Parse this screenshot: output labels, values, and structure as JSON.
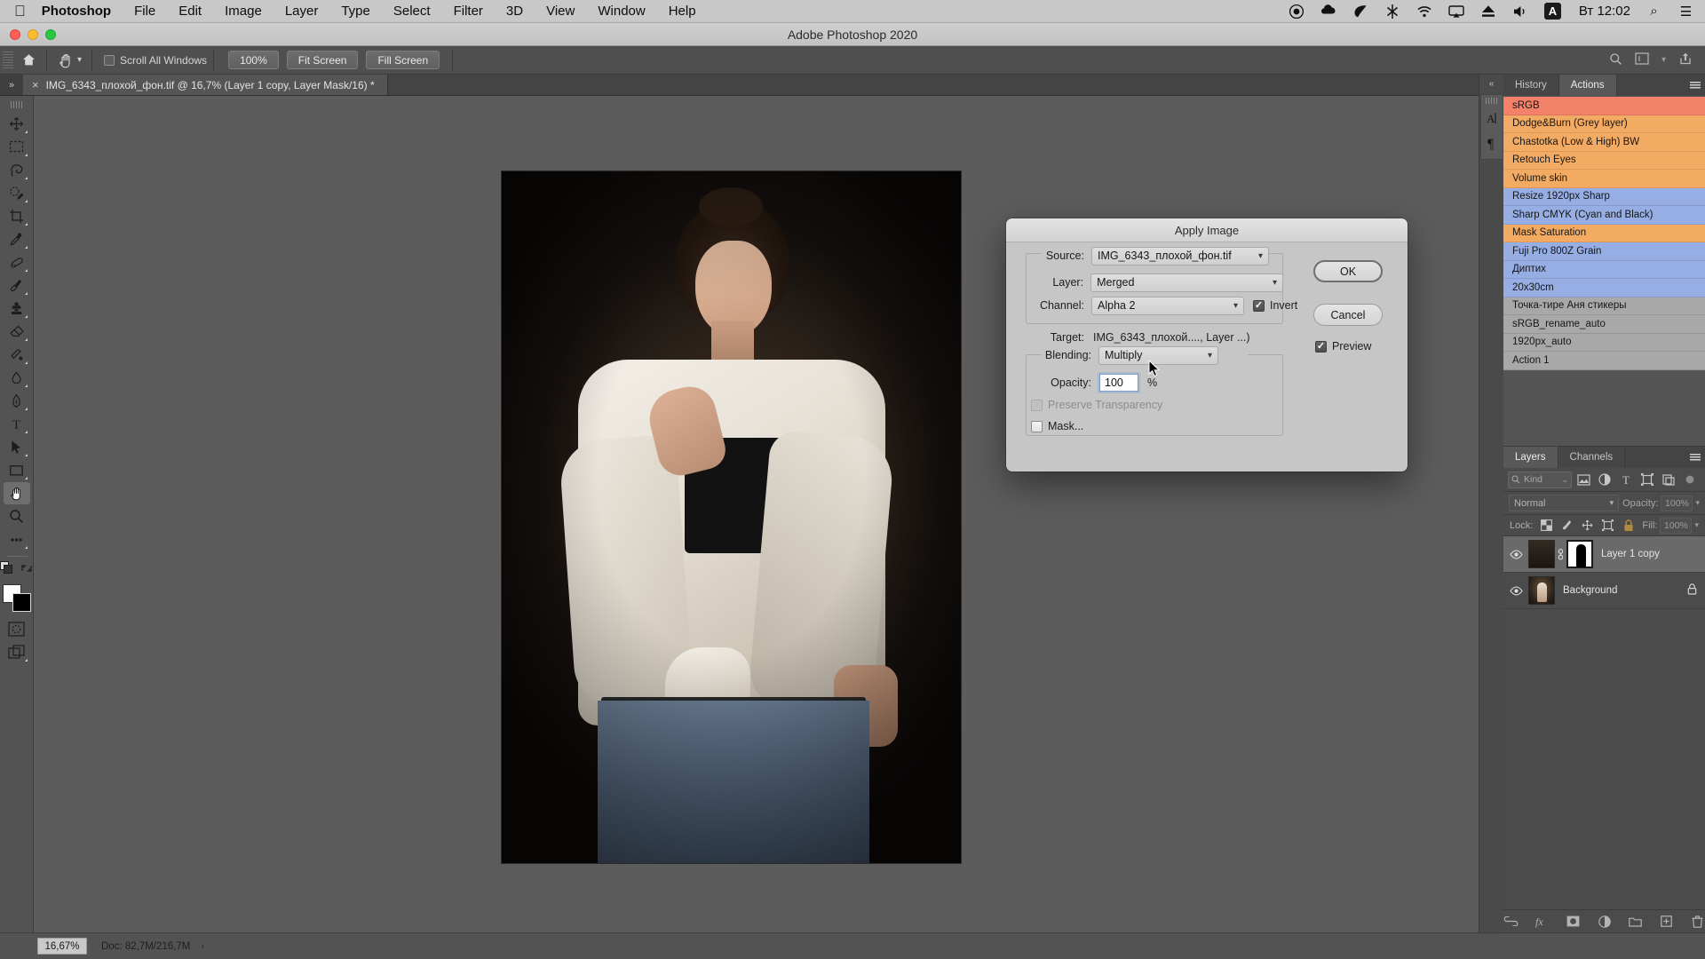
{
  "menubar": {
    "apple": "",
    "items": [
      {
        "label": "Photoshop",
        "bold": true
      },
      {
        "label": "File"
      },
      {
        "label": "Edit"
      },
      {
        "label": "Image"
      },
      {
        "label": "Layer"
      },
      {
        "label": "Type"
      },
      {
        "label": "Select"
      },
      {
        "label": "Filter"
      },
      {
        "label": "3D"
      },
      {
        "label": "View"
      },
      {
        "label": "Window"
      },
      {
        "label": "Help"
      }
    ],
    "status_icons": [
      {
        "name": "screen-record-icon",
        "glyph": "◉"
      },
      {
        "name": "creative-cloud-icon",
        "glyph": "❦"
      },
      {
        "name": "leaf-icon",
        "glyph": "🍃"
      },
      {
        "name": "bluetooth-mouse-icon",
        "glyph": "✳"
      },
      {
        "name": "wifi-icon",
        "glyph": "≋"
      },
      {
        "name": "airplay-icon",
        "glyph": "▭"
      },
      {
        "name": "eject-icon",
        "glyph": "⏏"
      },
      {
        "name": "volume-icon",
        "glyph": "🔊"
      }
    ],
    "input_badge": "A",
    "clock": "Вт 12:02",
    "search_icon": "⌕",
    "control_center_icon": "☰"
  },
  "window": {
    "title": "Adobe Photoshop 2020"
  },
  "options_bar": {
    "home_icon": "⌂",
    "tool_icon": "hand-tool-icon",
    "scroll_all_windows_label": "Scroll All Windows",
    "scroll_all_windows_checked": false,
    "buttons": [
      "100%",
      "Fit Screen",
      "Fill Screen"
    ],
    "right_icons": [
      {
        "name": "search-icon",
        "glyph": "⌕"
      },
      {
        "name": "workspace-icon",
        "glyph": "▤"
      },
      {
        "name": "chevron-down-icon",
        "glyph": "⌄"
      },
      {
        "name": "share-icon",
        "glyph": "⇧"
      }
    ]
  },
  "document_tab": {
    "collapse_icon": "»",
    "close_icon": "×",
    "title": "IMG_6343_плохой_фон.tif @ 16,7% (Layer 1 copy, Layer Mask/16) *"
  },
  "toolbar": {
    "tools": [
      {
        "name": "move-tool",
        "active": false
      },
      {
        "name": "rectangular-marquee-tool",
        "active": false
      },
      {
        "name": "lasso-tool",
        "active": false
      },
      {
        "name": "quick-selection-tool",
        "active": false
      },
      {
        "name": "crop-tool",
        "active": false
      },
      {
        "name": "eyedropper-tool",
        "active": false
      },
      {
        "name": "healing-brush-tool",
        "active": false
      },
      {
        "name": "brush-tool",
        "active": false
      },
      {
        "name": "clone-stamp-tool",
        "active": false
      },
      {
        "name": "eraser-tool",
        "active": false
      },
      {
        "name": "gradient-tool",
        "active": false
      },
      {
        "name": "blur-tool",
        "active": false
      },
      {
        "name": "pen-tool",
        "active": false
      },
      {
        "name": "type-tool",
        "active": false
      },
      {
        "name": "path-selection-tool",
        "active": false
      },
      {
        "name": "rectangle-tool",
        "active": false
      },
      {
        "name": "hand-tool",
        "active": true
      },
      {
        "name": "zoom-tool",
        "active": false
      },
      {
        "name": "edit-toolbar-tool",
        "active": false
      }
    ],
    "foreground_color": "#ffffff",
    "background_color": "#000000"
  },
  "collapsed_panels": {
    "arrow": "«",
    "items": [
      {
        "name": "character-panel-icon",
        "glyph": "A|"
      },
      {
        "name": "paragraph-panel-icon",
        "glyph": "¶"
      }
    ]
  },
  "actions_panel": {
    "tabs": [
      {
        "label": "History",
        "active": false
      },
      {
        "label": "Actions",
        "active": true
      }
    ],
    "menu_icon": "panel-menu-icon",
    "items": [
      {
        "label": "sRGB",
        "color": "#f4816a"
      },
      {
        "label": "Dodge&Burn (Grey layer)",
        "color": "#f3ab63"
      },
      {
        "label": "Chastotka (Low & High) BW",
        "color": "#f3ab63"
      },
      {
        "label": "Retouch Eyes",
        "color": "#f3ab63"
      },
      {
        "label": "Volume skin",
        "color": "#f3ab63"
      },
      {
        "label": "Resize 1920px Sharp",
        "color": "#96aee4"
      },
      {
        "label": "Sharp CMYK (Cyan and Black)",
        "color": "#96aee4"
      },
      {
        "label": "Mask Saturation",
        "color": "#f3ab63"
      },
      {
        "label": "Fuji Pro 800Z Grain",
        "color": "#96aee4"
      },
      {
        "label": "Диптих",
        "color": "#96aee4"
      },
      {
        "label": "20x30cm",
        "color": "#96aee4"
      },
      {
        "label": "Точка-тире Аня стикеры",
        "color": "#a8a8a8"
      },
      {
        "label": "sRGB_rename_auto",
        "color": "#a8a8a8"
      },
      {
        "label": "1920px_auto",
        "color": "#a8a8a8"
      },
      {
        "label": "Action 1",
        "color": "#a8a8a8"
      }
    ]
  },
  "layers_panel": {
    "tabs": [
      {
        "label": "Layers",
        "active": true
      },
      {
        "label": "Channels",
        "active": false
      }
    ],
    "menu_icon": "panel-menu-icon",
    "filter": {
      "search_icon": "search-icon",
      "kind_label": "Kind",
      "chevron": "⌄",
      "type_icons": [
        {
          "name": "filter-pixel-icon",
          "glyph": "▣"
        },
        {
          "name": "filter-adjustment-icon",
          "glyph": "◐"
        },
        {
          "name": "filter-type-icon",
          "glyph": "T"
        },
        {
          "name": "filter-shape-icon",
          "glyph": "⬚"
        },
        {
          "name": "filter-smart-object-icon",
          "glyph": "❐"
        }
      ],
      "toggle_icon": "filter-toggle-icon"
    },
    "blend_mode": "Normal",
    "opacity_label": "Opacity:",
    "opacity_value": "100%",
    "lock_label": "Lock:",
    "lock_icons": [
      {
        "name": "lock-transparent-pixels-icon",
        "glyph": "▨"
      },
      {
        "name": "lock-image-pixels-icon",
        "glyph": "✎"
      },
      {
        "name": "lock-position-icon",
        "glyph": "✥"
      },
      {
        "name": "lock-artboard-icon",
        "glyph": "⬚"
      },
      {
        "name": "lock-all-icon",
        "glyph": "🔒"
      }
    ],
    "fill_label": "Fill:",
    "fill_value": "100%",
    "layers": [
      {
        "name": "Layer 1 copy",
        "selected": true,
        "visible": true,
        "has_mask": true,
        "locked": false
      },
      {
        "name": "Background",
        "selected": false,
        "visible": true,
        "has_mask": false,
        "locked": true
      }
    ],
    "bottom_icons": [
      {
        "name": "link-layers-icon",
        "glyph": "⛓"
      },
      {
        "name": "layer-style-fx-icon",
        "glyph": "fx"
      },
      {
        "name": "add-layer-mask-icon",
        "glyph": "◧"
      },
      {
        "name": "new-adjustment-layer-icon",
        "glyph": "◑"
      },
      {
        "name": "new-group-icon",
        "glyph": "▭"
      },
      {
        "name": "new-layer-icon",
        "glyph": "⊞"
      },
      {
        "name": "delete-layer-icon",
        "glyph": "🗑"
      }
    ]
  },
  "status_bar": {
    "zoom": "16,67%",
    "doc_info": "Doc: 82,7M/216,7M",
    "arrow": "›"
  },
  "dialog": {
    "title": "Apply Image",
    "source_label": "Source:",
    "source_value": "IMG_6343_плохой_фон.tif",
    "layer_label": "Layer:",
    "layer_value": "Merged",
    "channel_label": "Channel:",
    "channel_value": "Alpha 2",
    "invert_label": "Invert",
    "invert_checked": true,
    "target_label": "Target:",
    "target_value": "IMG_6343_плохой...., Layer ...)",
    "blending_label": "Blending:",
    "blending_value": "Multiply",
    "opacity_label": "Opacity:",
    "opacity_value": "100",
    "percent_sign": "%",
    "preserve_transparency_label": "Preserve Transparency",
    "preserve_transparency_checked": false,
    "mask_label": "Mask...",
    "mask_checked": false,
    "ok_label": "OK",
    "cancel_label": "Cancel",
    "preview_label": "Preview",
    "preview_checked": true
  }
}
